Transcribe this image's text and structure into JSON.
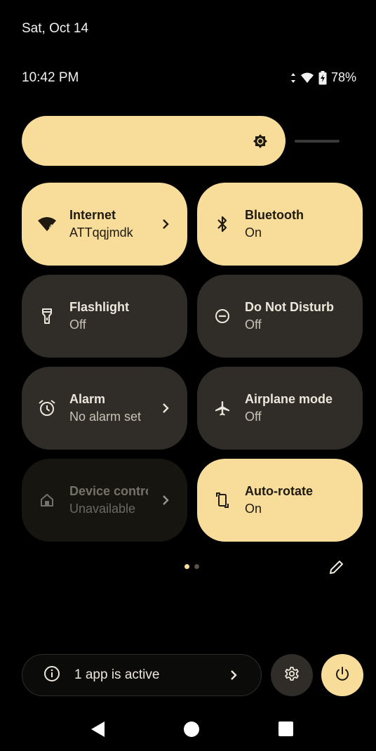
{
  "header": {
    "date": "Sat, Oct 14",
    "time": "10:42 PM",
    "battery_percent": "78%",
    "status_icons": [
      "data-arrows-icon",
      "wifi-icon",
      "battery-charging-icon"
    ]
  },
  "brightness": {
    "level": 0.83,
    "icon": "brightness-icon"
  },
  "tiles": [
    {
      "label": "Internet",
      "state": "ATTqqjmdk",
      "status": "on",
      "icon": "wifi-icon",
      "chevron": true
    },
    {
      "label": "Bluetooth",
      "state": "On",
      "status": "on",
      "icon": "bluetooth-icon",
      "chevron": false
    },
    {
      "label": "Flashlight",
      "state": "Off",
      "status": "off",
      "icon": "flashlight-icon",
      "chevron": false
    },
    {
      "label": "Do Not Disturb",
      "state": "Off",
      "status": "off",
      "icon": "do-not-disturb-icon",
      "chevron": false
    },
    {
      "label": "Alarm",
      "state": "No alarm set",
      "status": "off",
      "icon": "alarm-icon",
      "chevron": true
    },
    {
      "label": "Airplane mode",
      "state": "Off",
      "status": "off",
      "icon": "airplane-icon",
      "chevron": false
    },
    {
      "label": "Device controls",
      "state": "Unavailable",
      "status": "disabled",
      "icon": "home-icon",
      "chevron": true
    },
    {
      "label": "Auto-rotate",
      "state": "On",
      "status": "on",
      "icon": "rotate-icon",
      "chevron": false
    }
  ],
  "pager": {
    "current_page": 1,
    "total_pages": 2
  },
  "footer": {
    "active_apps_label": "1 app is active",
    "settings_icon": "gear-icon",
    "power_icon": "power-icon"
  },
  "colors": {
    "accent": "#f8dd9a",
    "tile_off": "#302c27",
    "tile_disabled": "#17150f",
    "background": "#000000"
  }
}
